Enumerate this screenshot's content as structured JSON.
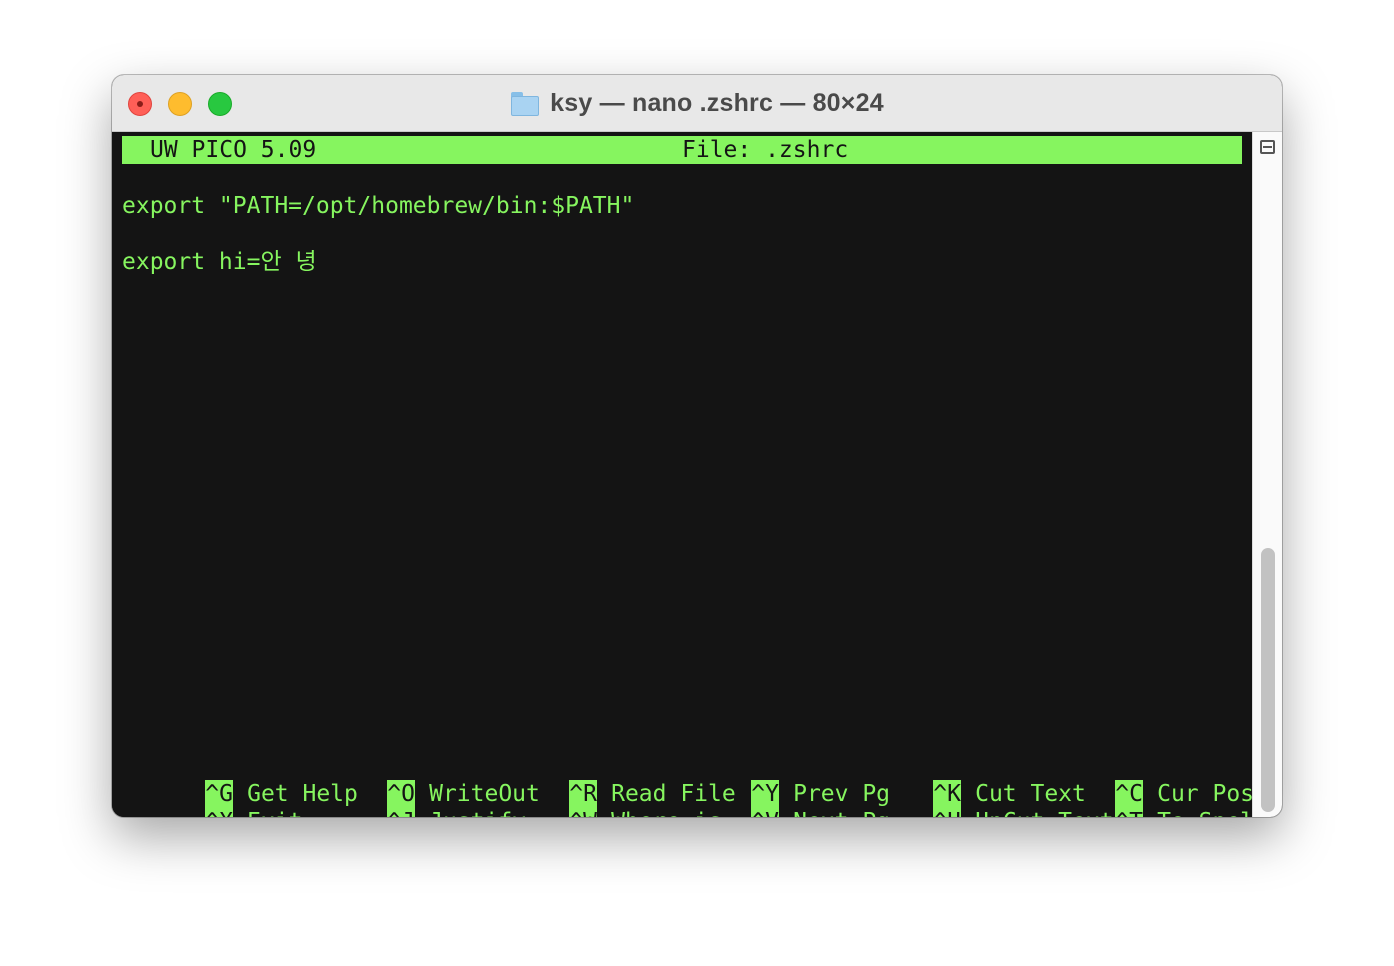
{
  "window": {
    "title": "ksy — nano .zshrc — 80×24",
    "title_icon": "folder-icon"
  },
  "editor": {
    "app_name": "UW PICO 5.09",
    "file_label": "File: .zshrc",
    "lines": [
      "export \"PATH=/opt/homebrew/bin:$PATH\"",
      "export hi=안 녕"
    ]
  },
  "shortcuts": {
    "row1": [
      {
        "key": "^G",
        "label": "Get Help"
      },
      {
        "key": "^O",
        "label": "WriteOut"
      },
      {
        "key": "^R",
        "label": "Read File"
      },
      {
        "key": "^Y",
        "label": "Prev Pg"
      },
      {
        "key": "^K",
        "label": "Cut Text"
      },
      {
        "key": "^C",
        "label": "Cur Pos"
      }
    ],
    "row2": [
      {
        "key": "^X",
        "label": "Exit"
      },
      {
        "key": "^J",
        "label": "Justify"
      },
      {
        "key": "^W",
        "label": "Where is"
      },
      {
        "key": "^V",
        "label": "Next Pg"
      },
      {
        "key": "^U",
        "label": "UnCut Text"
      },
      {
        "key": "^T",
        "label": "To Spell"
      }
    ]
  },
  "colors": {
    "terminal_fg": "#86f55f",
    "terminal_bg": "#141414",
    "titlebar_bg": "#e8e8e8"
  }
}
